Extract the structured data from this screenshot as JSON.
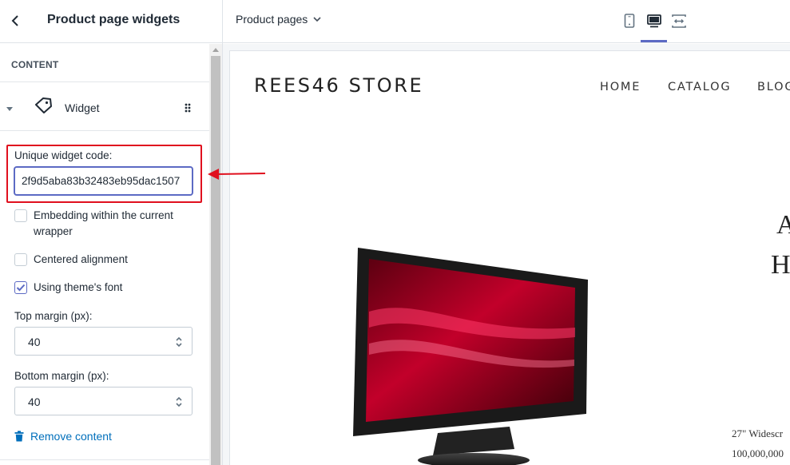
{
  "panel": {
    "title": "Product page widgets",
    "section_label": "CONTENT",
    "widget_label": "Widget",
    "code_label": "Unique widget code:",
    "code_value": "2f9d5aba83b32483eb95dac1507",
    "checkboxes": [
      {
        "label_line1": "Embedding within the current",
        "label_line2": "wrapper",
        "checked": false
      },
      {
        "label": "Centered alignment",
        "checked": false
      },
      {
        "label": "Using theme's font",
        "checked": true
      }
    ],
    "top_margin_label": "Top margin (px):",
    "top_margin_value": "40",
    "bottom_margin_label": "Bottom margin (px):",
    "bottom_margin_value": "40",
    "remove_label": "Remove content"
  },
  "topbar": {
    "page_select": "Product pages",
    "active_view": "desktop"
  },
  "preview": {
    "store_name": "REES46 STORE",
    "nav": [
      "HOME",
      "CATALOG",
      "BLOG"
    ],
    "product_title_lines": [
      "A",
      "H"
    ],
    "product_meta": [
      "27\" Widescr",
      "100,000,000"
    ]
  },
  "colors": {
    "accent": "#5c6ac4",
    "highlight": "#e0101e",
    "link": "#006fbb"
  },
  "icons": [
    "back-arrow-icon",
    "caret-down-icon",
    "tag-icon",
    "drag-handle-icon",
    "check-icon",
    "select-arrows-icon",
    "trash-icon",
    "chevron-down-icon",
    "mobile-view-icon",
    "desktop-view-icon",
    "fullscreen-view-icon",
    "arrow-icon"
  ]
}
